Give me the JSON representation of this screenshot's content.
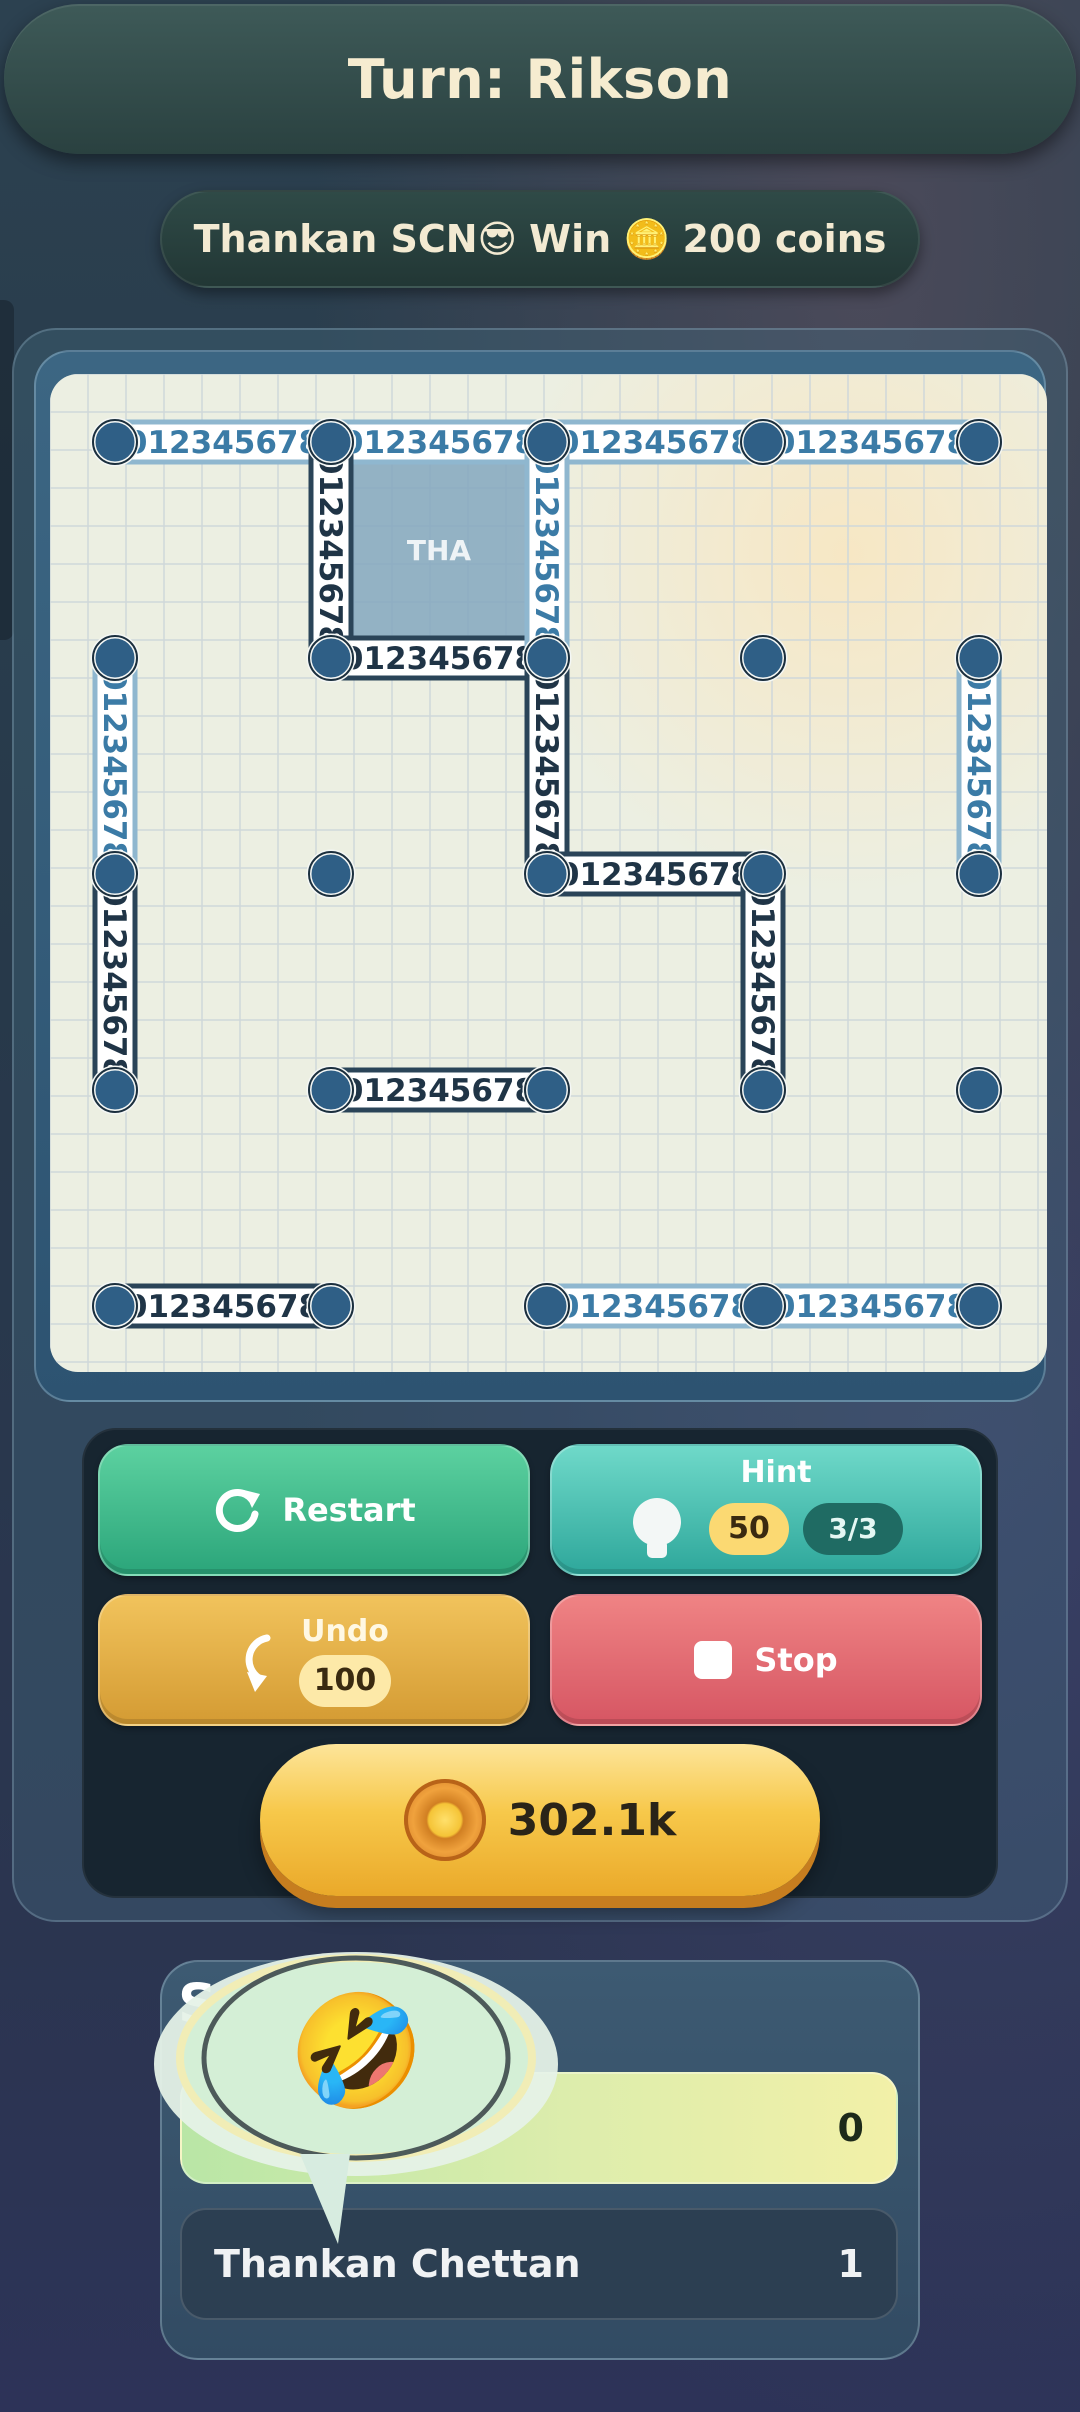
{
  "header": {
    "turn_text": "Turn: Rikson"
  },
  "prize_banner": {
    "winner": "Thankan SCN😎",
    "win_word": "Win",
    "coin_emoji": "🪙",
    "amount_text": "200 coins"
  },
  "board": {
    "grid_size": [
      5,
      5
    ],
    "edge_label_text": "012345678",
    "claimed_boxes": [
      {
        "row": 0,
        "col": 1,
        "owner_label": "THA"
      }
    ],
    "colors": {
      "board_bg": "#ecefe2",
      "claimed_box": "#84a7be",
      "dot_fill": "#2f5f86",
      "line_dark": "#2a4458",
      "line_light": "#8fb7cf"
    }
  },
  "controls": {
    "restart_label": "Restart",
    "hint_label": "Hint",
    "hint_cost": "50",
    "hint_count": "3/3",
    "undo_label": "Undo",
    "undo_cost": "100",
    "stop_label": "Stop",
    "coins_balance": "302.1k"
  },
  "scoreboard": {
    "title_visible_letter": "S",
    "players": [
      {
        "name": "",
        "score": "0",
        "active": true
      },
      {
        "name": "Thankan Chettan",
        "score": "1",
        "active": false
      }
    ]
  },
  "emote": {
    "emoji": "🤣"
  }
}
